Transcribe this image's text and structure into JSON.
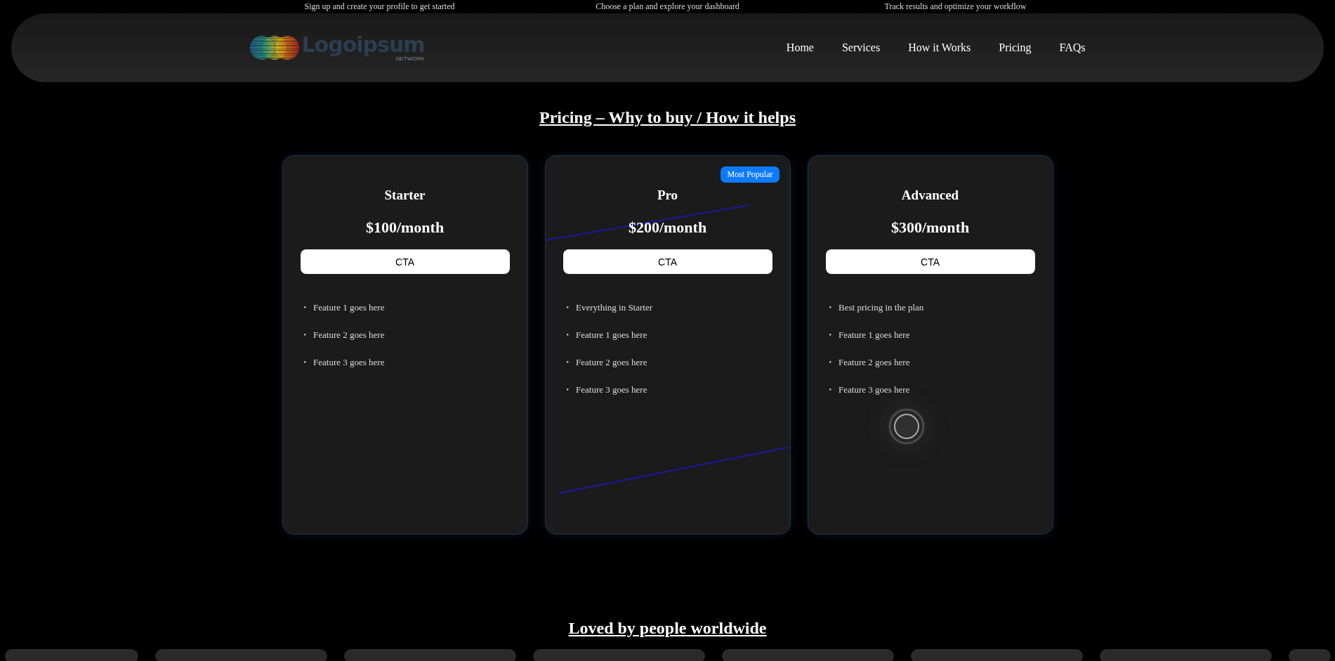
{
  "steps": [
    "Sign up and create your profile to get started",
    "Choose a plan and explore your dashboard",
    "Track results and optimize your workflow"
  ],
  "header": {
    "logo": {
      "name": "Logoipsum",
      "tagline": "NETWORK"
    },
    "nav": [
      "Home",
      "Services",
      "How it Works",
      "Pricing",
      "FAQs"
    ]
  },
  "pricing": {
    "title": "Pricing – Why to buy / How it helps",
    "bullet": "•",
    "plans": [
      {
        "name": "Starter",
        "price": "$100/month",
        "cta": "CTA",
        "features": [
          "Feature 1 goes here",
          "Feature 2 goes here",
          "Feature 3 goes here"
        ]
      },
      {
        "name": "Pro",
        "price": "$200/month",
        "cta": "CTA",
        "badge": "Most Popular",
        "features": [
          "Everything in Starter",
          "Feature 1 goes here",
          "Feature 2 goes here",
          "Feature 3 goes here"
        ]
      },
      {
        "name": "Advanced",
        "price": "$300/month",
        "cta": "CTA",
        "features": [
          "Best pricing in the plan",
          "Feature 1 goes here",
          "Feature 2 goes here",
          "Feature 3 goes here"
        ]
      }
    ]
  },
  "testimonials": {
    "title": "Loved by people worldwide"
  }
}
